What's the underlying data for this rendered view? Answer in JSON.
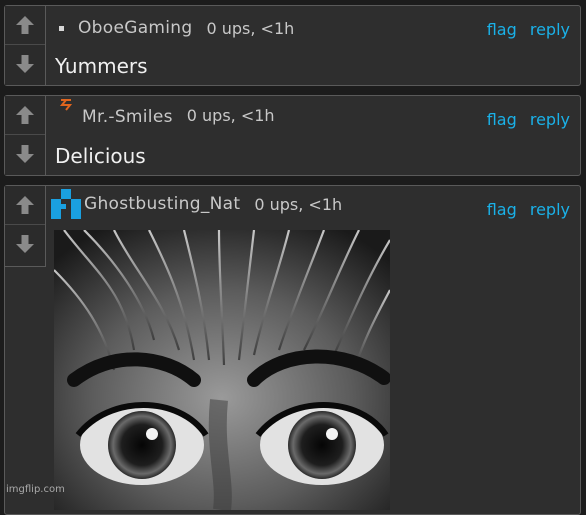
{
  "comments": [
    {
      "username": "OboeGaming",
      "ups": "0 ups, <1h",
      "flag": "flag",
      "reply": "reply",
      "text": "Yummers"
    },
    {
      "username": "Mr.-Smiles",
      "ups": "0 ups, <1h",
      "flag": "flag",
      "reply": "reply",
      "text": "Delicious"
    },
    {
      "username": "Ghostbusting_Nat",
      "ups": "0 ups, <1h",
      "flag": "flag",
      "reply": "reply",
      "image": "black-and-white close-up of wide eyes"
    }
  ],
  "watermark": "imgflip.com",
  "colors": {
    "accent": "#1ab1e8",
    "smiles_icon": "#e0651e",
    "nat_icon": "#1aa0e0"
  },
  "icons": {
    "upvote": "up-arrow-icon",
    "downvote": "down-arrow-icon"
  }
}
